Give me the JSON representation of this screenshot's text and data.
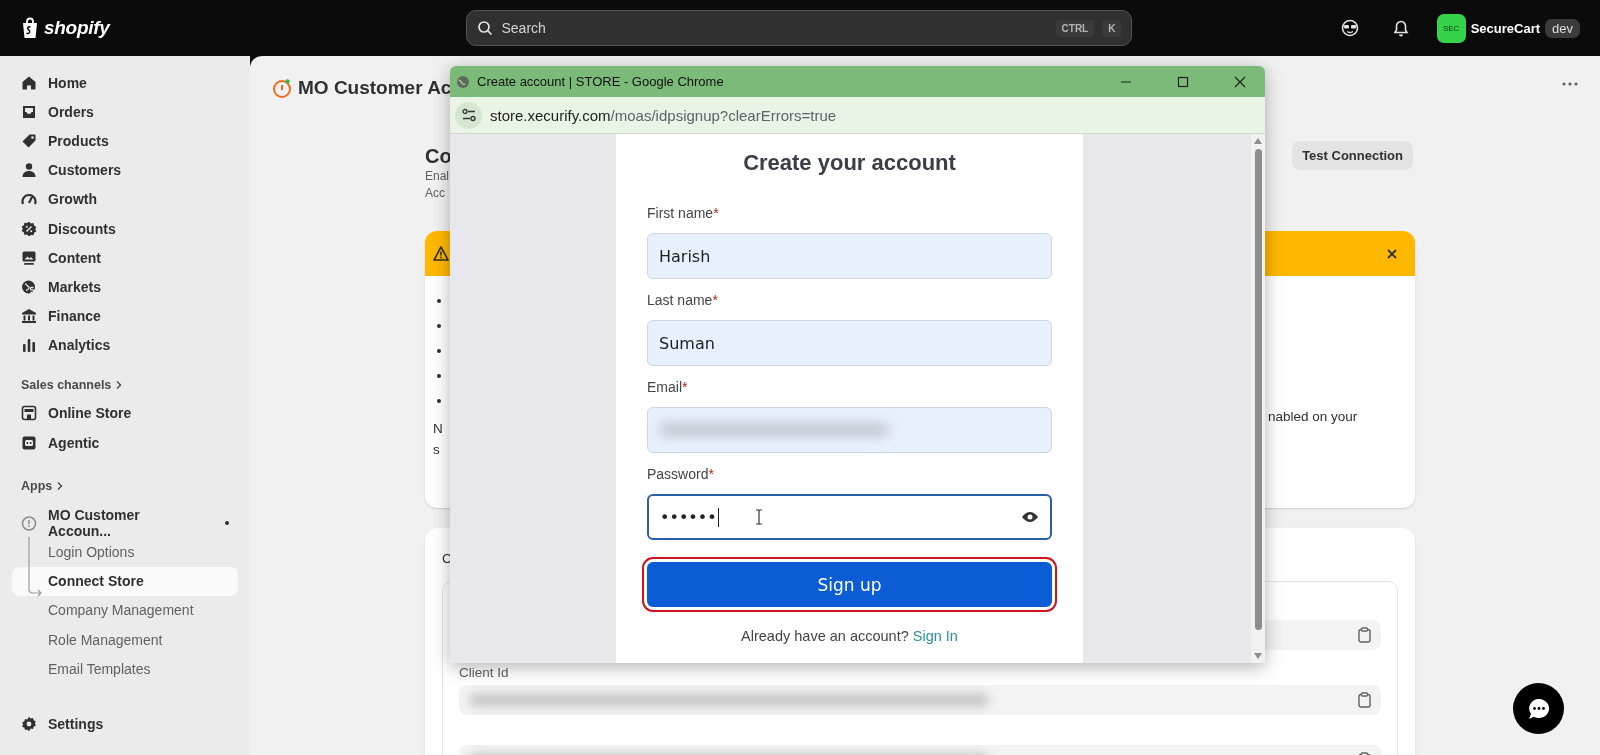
{
  "top_bar": {
    "logo": "shopify",
    "search": {
      "placeholder": "Search",
      "shortcut": [
        "CTRL",
        "K"
      ]
    },
    "store": {
      "badge": "SEC",
      "name": "SecureCart",
      "tag": "dev"
    }
  },
  "sidebar": {
    "main_items": [
      {
        "label": "Home",
        "selected": false
      },
      {
        "label": "Orders",
        "selected": false
      },
      {
        "label": "Products",
        "selected": false
      },
      {
        "label": "Customers",
        "selected": false
      },
      {
        "label": "Growth",
        "selected": false
      },
      {
        "label": "Discounts",
        "selected": false
      },
      {
        "label": "Content",
        "selected": false
      },
      {
        "label": "Markets",
        "selected": false
      },
      {
        "label": "Finance",
        "selected": false
      },
      {
        "label": "Analytics",
        "selected": false
      }
    ],
    "sales_channels": {
      "heading": "Sales channels",
      "items": [
        {
          "label": "Online Store",
          "selected": false
        },
        {
          "label": "Agentic",
          "selected": false
        }
      ]
    },
    "apps": {
      "heading": "Apps",
      "app": {
        "label": "MO Customer Accoun...",
        "pinned": true,
        "children": [
          {
            "label": "Login Options",
            "selected": false
          },
          {
            "label": "Connect Store",
            "selected": true
          },
          {
            "label": "Company Management",
            "selected": false
          },
          {
            "label": "Role Management",
            "selected": false
          },
          {
            "label": "Email Templates",
            "selected": false
          }
        ]
      }
    },
    "settings": "Settings"
  },
  "page": {
    "title": "MO Customer Ac",
    "heading": "Co",
    "description": [
      "Enal",
      "Acc"
    ],
    "test_button": "Test Connection",
    "warning_card": {
      "left_text": [
        "N",
        "s"
      ],
      "right_text": "nabled on your"
    },
    "credentials_card": {
      "heading": "C",
      "field_label": "Client Id"
    }
  },
  "browser_popup": {
    "title": "Create account | STORE - Google Chrome",
    "url": {
      "host": "store.xecurify.com",
      "path": "/moas/idpsignup?clearErrors=true"
    },
    "form": {
      "heading": "Create your account",
      "fields": [
        {
          "label": "First name",
          "required_mark": "*",
          "kind": "text",
          "value": "Harish",
          "focused": false
        },
        {
          "label": "Last name",
          "required_mark": "*",
          "kind": "text",
          "value": "Suman",
          "focused": false
        },
        {
          "label": "Email",
          "required_mark": "*",
          "kind": "redacted",
          "focused": false
        },
        {
          "label": "Password",
          "required_mark": "*",
          "kind": "password",
          "value": "••••••",
          "focused": true
        }
      ],
      "submit": {
        "label": "Sign up",
        "highlighted": true
      },
      "footer": {
        "text": "Already have an account?",
        "link": "Sign In"
      }
    }
  }
}
